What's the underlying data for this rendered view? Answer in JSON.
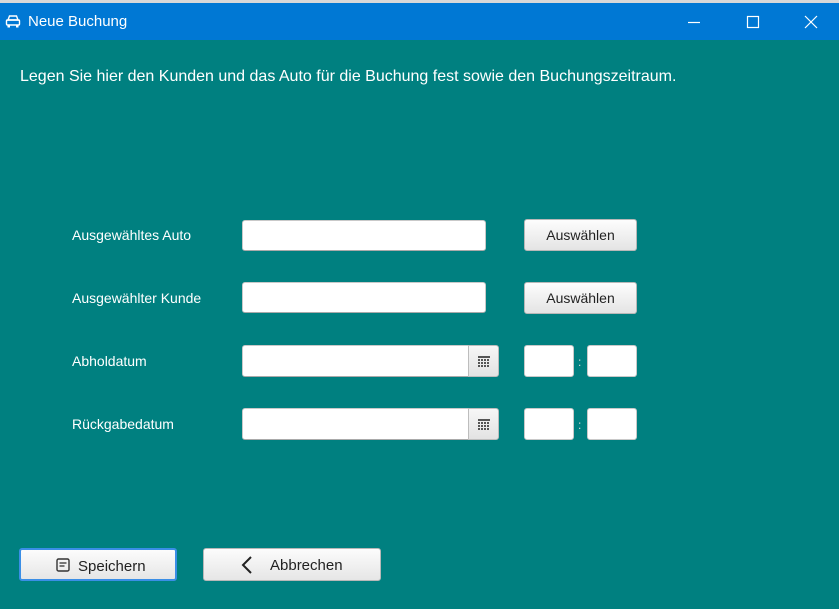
{
  "window": {
    "title": "Neue Buchung",
    "icon": "car-icon",
    "controls": [
      "minimize-icon",
      "maximize-icon",
      "close-icon"
    ],
    "titlebar_color": "#0078d4"
  },
  "colors": {
    "background": "#008080",
    "text": "#ffffff"
  },
  "intro_text": "Legen Sie hier den Kunden und das Auto für die Buchung fest sowie den Buchungszeitraum.",
  "form": {
    "car": {
      "label": "Ausgewähltes Auto",
      "value": "",
      "button": "Auswählen"
    },
    "customer": {
      "label": "Ausgewählter Kunde",
      "value": "",
      "button": "Auswählen"
    },
    "pickup": {
      "label": "Abholdatum",
      "date": "",
      "hour": "",
      "minute": "",
      "separator": ":",
      "picker_icon": "calendar-icon"
    },
    "return": {
      "label": "Rückgabedatum",
      "date": "",
      "hour": "",
      "minute": "",
      "separator": ":",
      "picker_icon": "calendar-icon"
    }
  },
  "footer": {
    "save": {
      "label": "Speichern",
      "icon": "save-icon"
    },
    "cancel": {
      "label": "Abbrechen",
      "icon": "chevron-left-icon"
    }
  }
}
